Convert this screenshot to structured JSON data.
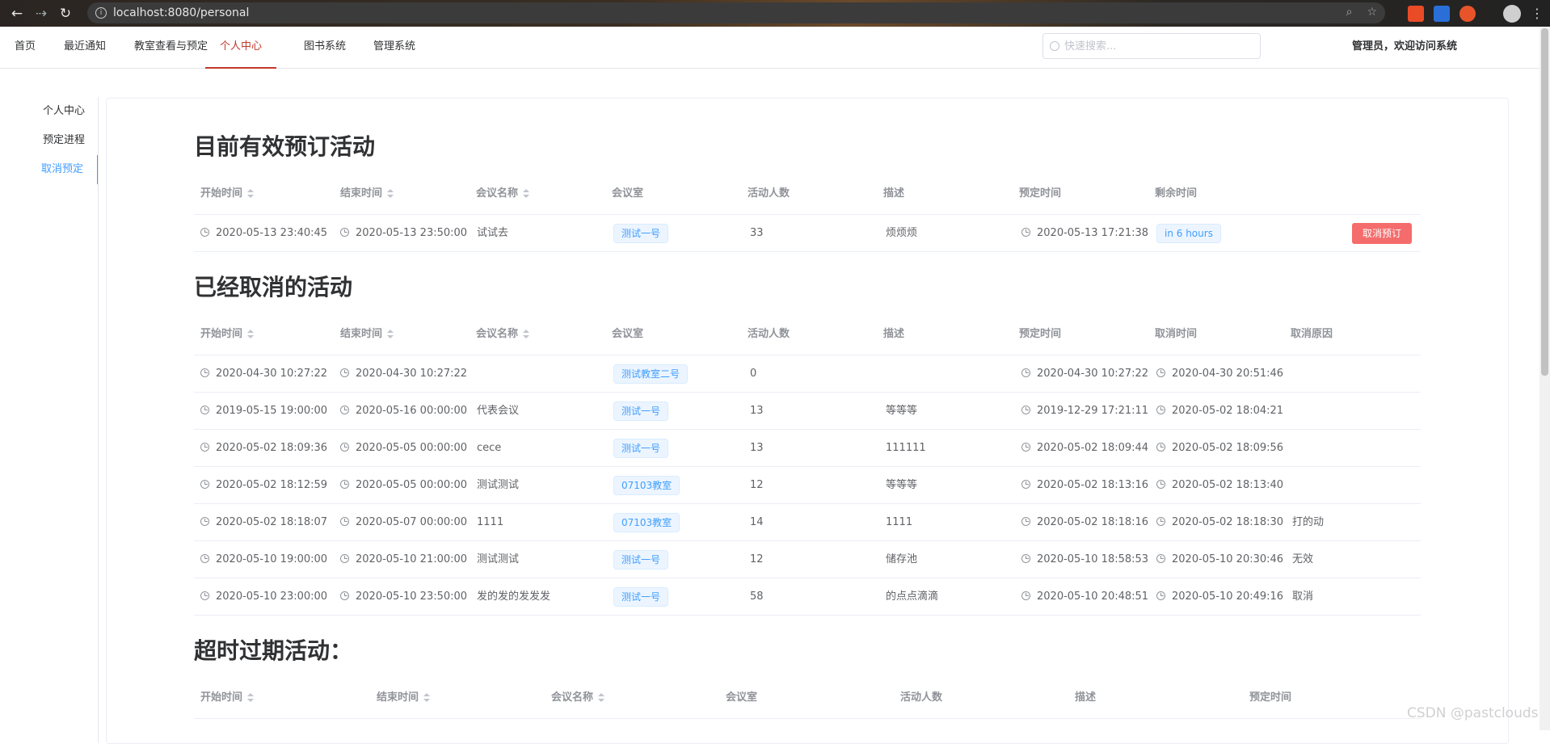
{
  "browser": {
    "url": "localhost:8080/personal"
  },
  "topnav": {
    "items": [
      "首页",
      "最近通知",
      "教室查看与预定",
      "个人中心",
      "图书系统",
      "管理系统"
    ],
    "active_index": 3,
    "search_placeholder": "快速搜索...",
    "welcome": "管理员，欢迎访问系统"
  },
  "sidemenu": {
    "items": [
      "个人中心",
      "预定进程",
      "取消预定"
    ],
    "active_index": 2
  },
  "active_section": {
    "title": "目前有效预订活动",
    "headers": [
      "开始时间",
      "结束时间",
      "会议名称",
      "会议室",
      "活动人数",
      "描述",
      "预定时间",
      "剩余时间"
    ],
    "rows": [
      {
        "start": "2020-05-13 23:40:45",
        "end": "2020-05-13 23:50:00",
        "name": "试试去",
        "room": "测试一号",
        "people": "33",
        "desc": "烦烦烦",
        "booked": "2020-05-13 17:21:38",
        "remain": "in 6 hours",
        "action": "取消预订"
      }
    ]
  },
  "cancelled_section": {
    "title": "已经取消的活动",
    "headers": [
      "开始时间",
      "结束时间",
      "会议名称",
      "会议室",
      "活动人数",
      "描述",
      "预定时间",
      "取消时间",
      "取消原因"
    ],
    "rows": [
      {
        "start": "2020-04-30 10:27:22",
        "end": "2020-04-30 10:27:22",
        "name": "",
        "room": "测试教室二号",
        "people": "0",
        "desc": "",
        "booked": "2020-04-30 10:27:22",
        "cancelled": "2020-04-30 20:51:46",
        "reason": ""
      },
      {
        "start": "2019-05-15 19:00:00",
        "end": "2020-05-16 00:00:00",
        "name": "代表会议",
        "room": "测试一号",
        "people": "13",
        "desc": "等等等",
        "booked": "2019-12-29 17:21:11",
        "cancelled": "2020-05-02 18:04:21",
        "reason": ""
      },
      {
        "start": "2020-05-02 18:09:36",
        "end": "2020-05-05 00:00:00",
        "name": "cece",
        "room": "测试一号",
        "people": "13",
        "desc": "111111",
        "booked": "2020-05-02 18:09:44",
        "cancelled": "2020-05-02 18:09:56",
        "reason": ""
      },
      {
        "start": "2020-05-02 18:12:59",
        "end": "2020-05-05 00:00:00",
        "name": "测试测试",
        "room": "07103教室",
        "people": "12",
        "desc": "等等等",
        "booked": "2020-05-02 18:13:16",
        "cancelled": "2020-05-02 18:13:40",
        "reason": ""
      },
      {
        "start": "2020-05-02 18:18:07",
        "end": "2020-05-07 00:00:00",
        "name": "1111",
        "room": "07103教室",
        "people": "14",
        "desc": "1111",
        "booked": "2020-05-02 18:18:16",
        "cancelled": "2020-05-02 18:18:30",
        "reason": "打的动"
      },
      {
        "start": "2020-05-10 19:00:00",
        "end": "2020-05-10 21:00:00",
        "name": "测试测试",
        "room": "测试一号",
        "people": "12",
        "desc": "储存池",
        "booked": "2020-05-10 18:58:53",
        "cancelled": "2020-05-10 20:30:46",
        "reason": "无效"
      },
      {
        "start": "2020-05-10 23:00:00",
        "end": "2020-05-10 23:50:00",
        "name": "发的发的发发发",
        "room": "测试一号",
        "people": "58",
        "desc": "的点点滴滴",
        "booked": "2020-05-10 20:48:51",
        "cancelled": "2020-05-10 20:49:16",
        "reason": "取消"
      }
    ]
  },
  "expired_section": {
    "title": "超时过期活动：",
    "headers": [
      "开始时间",
      "结束时间",
      "会议名称",
      "会议室",
      "活动人数",
      "描述",
      "预定时间"
    ]
  },
  "watermark": "CSDN @pastclouds"
}
